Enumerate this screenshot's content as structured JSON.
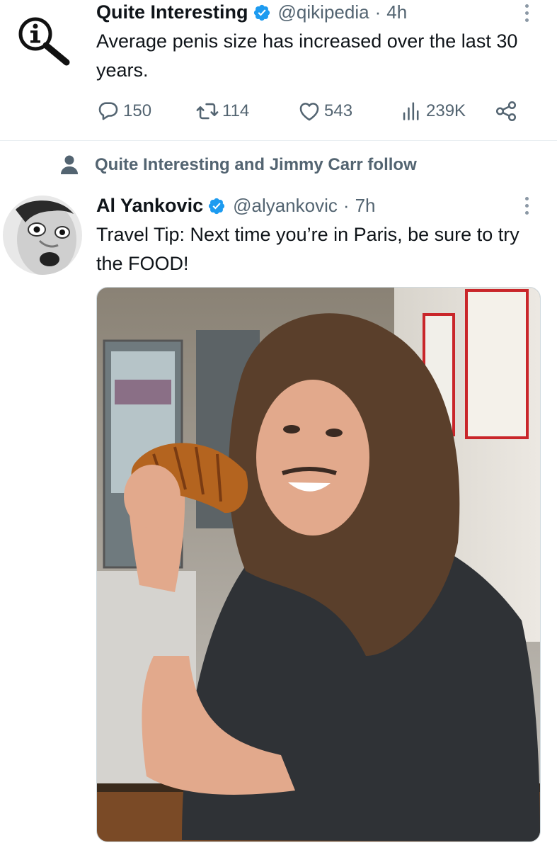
{
  "tweet1": {
    "name": "Quite Interesting",
    "handle": "@qikipedia",
    "separator": "·",
    "time": "4h",
    "text": "Average penis size has increased over the last 30 years.",
    "replies": "150",
    "retweets": "114",
    "likes": "543",
    "views": "239K"
  },
  "tweet2": {
    "social_context": "Quite Interesting and Jimmy Carr follow",
    "name": "Al Yankovic",
    "handle": "@alyankovic",
    "separator": "·",
    "time": "7h",
    "text": "Travel Tip: Next time you’re in Paris, be sure to try the FOOD!",
    "photo_description": "photo-of-man-holding-croissant"
  },
  "colors": {
    "verified": "#1d9bf0",
    "secondary_text": "#536471",
    "primary_text": "#0f1419"
  }
}
